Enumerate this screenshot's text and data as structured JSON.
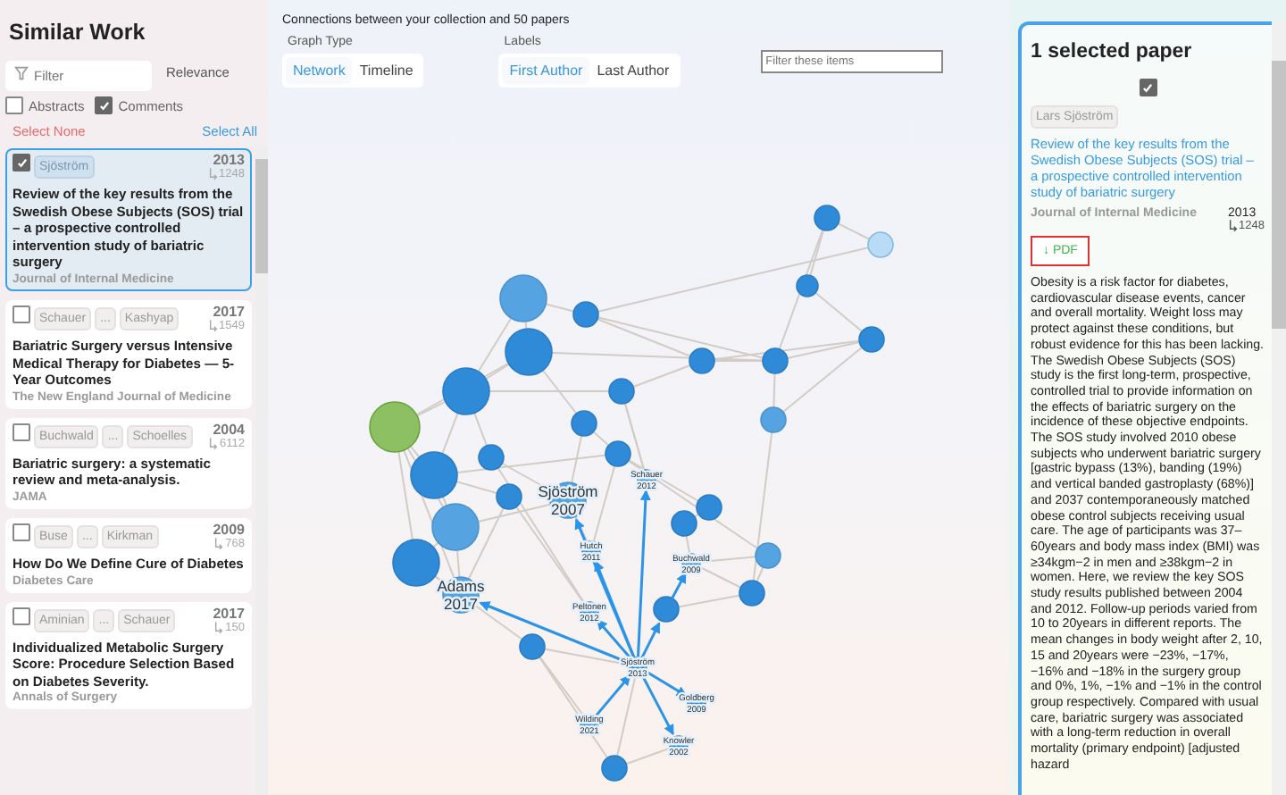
{
  "sidebar": {
    "title": "Similar Work",
    "filter": {
      "placeholder": "Filter"
    },
    "sort": "Relevance",
    "toggles": [
      {
        "label": "Abstracts",
        "checked": false
      },
      {
        "label": "Comments",
        "checked": true
      }
    ],
    "select_none": "Select None",
    "select_all": "Select All",
    "papers": [
      {
        "selected": true,
        "authors": [
          "Sjöström"
        ],
        "year": "2013",
        "citations": "1248",
        "title": "Review of the key results from the Swedish Obese Subjects (SOS) trial – a prospective controlled intervention study of bariatric surgery",
        "journal": "Journal of Internal Medicine"
      },
      {
        "selected": false,
        "authors": [
          "Schauer",
          "...",
          "Kashyap"
        ],
        "year": "2017",
        "citations": "1549",
        "title": "Bariatric Surgery versus Intensive Medical Therapy for Diabetes — 5-Year Outcomes",
        "journal": "The New England Journal of Medicine"
      },
      {
        "selected": false,
        "authors": [
          "Buchwald",
          "...",
          "Schoelles"
        ],
        "year": "2004",
        "citations": "6112",
        "title": "Bariatric surgery: a systematic review and meta-analysis.",
        "journal": "JAMA"
      },
      {
        "selected": false,
        "authors": [
          "Buse",
          "...",
          "Kirkman"
        ],
        "year": "2009",
        "citations": "768",
        "title": "How Do We Define Cure of Diabetes",
        "journal": "Diabetes Care"
      },
      {
        "selected": false,
        "authors": [
          "Aminian",
          "...",
          "Schauer"
        ],
        "year": "2017",
        "citations": "150",
        "title": "Individualized Metabolic Surgery Score: Procedure Selection Based on Diabetes Severity.",
        "journal": "Annals of Surgery"
      }
    ]
  },
  "graph": {
    "caption": "Connections between your collection and 50 papers",
    "graph_type": {
      "label": "Graph Type",
      "options": [
        {
          "label": "Network",
          "selected": true
        },
        {
          "label": "Timeline",
          "selected": false
        }
      ]
    },
    "labels": {
      "label": "Labels",
      "options": [
        {
          "label": "First Author",
          "selected": true
        },
        {
          "label": "Last Author",
          "selected": false
        }
      ]
    },
    "filter": {
      "placeholder": "Filter these items"
    },
    "node_labels": [
      {
        "name": "Sjöström",
        "year": "2007"
      },
      {
        "name": "Schauer",
        "year": "2012"
      },
      {
        "name": "Hutch",
        "year": "2011"
      },
      {
        "name": "Buchwald",
        "year": "2009"
      },
      {
        "name": "Adams",
        "year": "2017"
      },
      {
        "name": "Peltonen",
        "year": "2012"
      },
      {
        "name": "Sjöström",
        "year": "2013"
      },
      {
        "name": "Goldberg",
        "year": "2009"
      },
      {
        "name": "Wilding",
        "year": "2021"
      },
      {
        "name": "Knowler",
        "year": "2002"
      }
    ]
  },
  "detail": {
    "title": "1 selected paper",
    "checked": true,
    "authors": [
      "Lars Sjöström"
    ],
    "paper_title": "Review of the key results from the Swedish Obese Subjects (SOS) trial – a prospective controlled intervention study of bariatric surgery",
    "journal": "Journal of Internal Medicine",
    "year": "2013",
    "citations": "1248",
    "pdf": "↓ PDF",
    "abstract": "Obesity is a risk factor for diabetes, cardiovascular disease events, cancer and overall mortality. Weight loss may protect against these conditions, but robust evidence for this has been lacking. The Swedish Obese Subjects (SOS) study is the first long-term, prospective, controlled trial to provide information on the effects of bariatric surgery on the incidence of these objective endpoints. The SOS study involved 2010 obese subjects who underwent bariatric surgery [gastric bypass (13%), banding (19%) and vertical banded gastroplasty (68%)] and 2037 contemporaneously matched obese control subjects receiving usual care. The age of participants was 37–60years and body mass index (BMI) was ≥34kgm−2 in men and ≥38kgm−2 in women. Here, we review the key SOS study results published between 2004 and 2012. Follow-up periods varied from 10 to 20years in different reports. The mean changes in body weight after 2, 10, 15 and 20years were −23%, −17%, −16% and −18% in the surgery group and 0%, 1%, −1% and −1% in the control group respectively. Compared with usual care, bariatric surgery was associated with a long-term reduction in overall mortality (primary endpoint) [adjusted hazard"
  }
}
